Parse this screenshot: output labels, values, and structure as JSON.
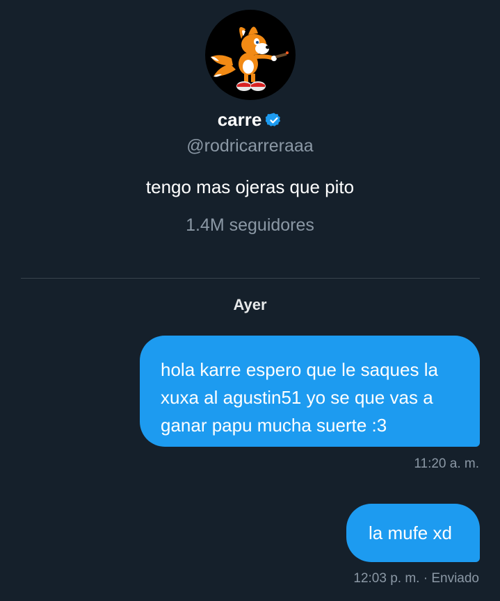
{
  "profile": {
    "name": "carre",
    "verified": true,
    "handle": "@rodricarreraaa",
    "bio": "tengo mas ojeras que pito",
    "followers": "1.4M seguidores"
  },
  "conversation": {
    "day_label": "Ayer",
    "messages": [
      {
        "text": "hola karre espero que le saques la xuxa al agustin51 yo se que vas a ganar papu mucha suerte :3",
        "time": "11:20 a. m.",
        "status": ""
      },
      {
        "text": "la mufe xd",
        "time": "12:03 p. m.",
        "status": " · Enviado"
      }
    ]
  },
  "colors": {
    "background": "#15202b",
    "bubble": "#1d9bf0",
    "secondary_text": "#8b98a5",
    "divider": "#38444d",
    "verified_badge": "#1d9bf0"
  },
  "icons": {
    "avatar": "fox-character-avatar",
    "verified": "verified-badge-icon"
  }
}
